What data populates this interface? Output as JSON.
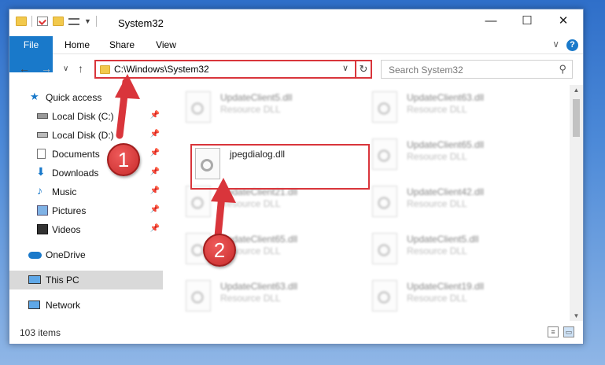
{
  "window": {
    "title": "System32",
    "controls": {
      "minimize": "—",
      "maximize": "☐",
      "close": "✕"
    }
  },
  "ribbon": {
    "tabs": [
      "File",
      "Home",
      "Share",
      "View"
    ],
    "expand": "∨",
    "help": "?"
  },
  "nav": {
    "back": "←",
    "forward": "→",
    "recent": "∨",
    "up": "↑",
    "address": "C:\\Windows\\System32",
    "address_dropdown": "∨",
    "refresh": "↻",
    "search_placeholder": "Search System32",
    "search_icon": "⚲"
  },
  "sidebar": {
    "items": [
      {
        "label": "Quick access",
        "icon": "star-icon",
        "pinned": false
      },
      {
        "label": "Local Disk (C:)",
        "icon": "drive-icon",
        "pinned": true
      },
      {
        "label": "Local Disk (D:)",
        "icon": "drive-icon",
        "pinned": true
      },
      {
        "label": "Documents",
        "icon": "documents-icon",
        "pinned": true
      },
      {
        "label": "Downloads",
        "icon": "download-icon",
        "pinned": true
      },
      {
        "label": "Music",
        "icon": "music-icon",
        "pinned": true
      },
      {
        "label": "Pictures",
        "icon": "pictures-icon",
        "pinned": true
      },
      {
        "label": "Videos",
        "icon": "videos-icon",
        "pinned": true
      },
      {
        "label": "OneDrive",
        "icon": "cloud-icon",
        "pinned": false
      },
      {
        "label": "This PC",
        "icon": "computer-icon",
        "pinned": false,
        "selected": true
      },
      {
        "label": "Network",
        "icon": "network-icon",
        "pinned": false
      }
    ],
    "pin_glyph": "📌"
  },
  "files": {
    "type_label": "Resource DLL",
    "left_column": [
      "UpdateClient5.dll",
      "jpegdialog.dll",
      "UpdateClient21.dll",
      "UpdateClient65.dll",
      "UpdateClient63.dll"
    ],
    "right_column": [
      "UpdateClient63.dll",
      "UpdateClient65.dll",
      "UpdateClient42.dll",
      "UpdateClient5.dll",
      "UpdateClient19.dll"
    ],
    "highlighted": "jpegdialog.dll"
  },
  "status": {
    "item_count": "103 items"
  },
  "annotations": {
    "step1": "1",
    "step2": "2",
    "accent_color": "#d9353b"
  }
}
